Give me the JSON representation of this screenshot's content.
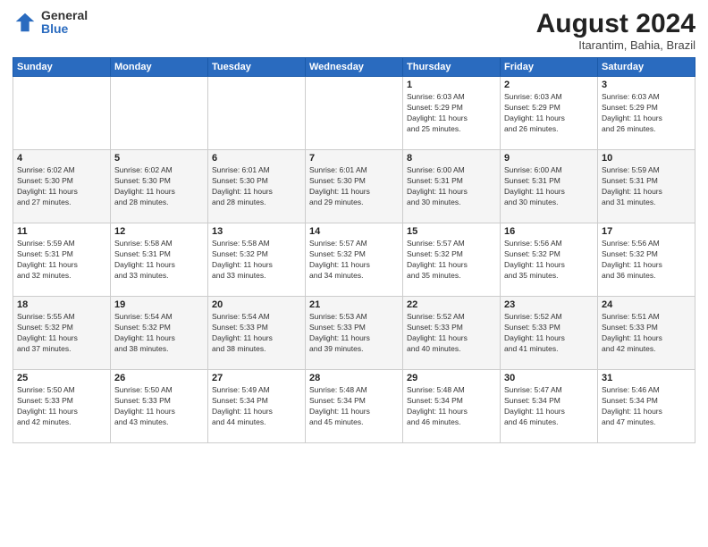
{
  "header": {
    "logo_general": "General",
    "logo_blue": "Blue",
    "month_year": "August 2024",
    "location": "Itarantim, Bahia, Brazil"
  },
  "weekdays": [
    "Sunday",
    "Monday",
    "Tuesday",
    "Wednesday",
    "Thursday",
    "Friday",
    "Saturday"
  ],
  "weeks": [
    [
      {
        "day": "",
        "info": ""
      },
      {
        "day": "",
        "info": ""
      },
      {
        "day": "",
        "info": ""
      },
      {
        "day": "",
        "info": ""
      },
      {
        "day": "1",
        "info": "Sunrise: 6:03 AM\nSunset: 5:29 PM\nDaylight: 11 hours\nand 25 minutes."
      },
      {
        "day": "2",
        "info": "Sunrise: 6:03 AM\nSunset: 5:29 PM\nDaylight: 11 hours\nand 26 minutes."
      },
      {
        "day": "3",
        "info": "Sunrise: 6:03 AM\nSunset: 5:29 PM\nDaylight: 11 hours\nand 26 minutes."
      }
    ],
    [
      {
        "day": "4",
        "info": "Sunrise: 6:02 AM\nSunset: 5:30 PM\nDaylight: 11 hours\nand 27 minutes."
      },
      {
        "day": "5",
        "info": "Sunrise: 6:02 AM\nSunset: 5:30 PM\nDaylight: 11 hours\nand 28 minutes."
      },
      {
        "day": "6",
        "info": "Sunrise: 6:01 AM\nSunset: 5:30 PM\nDaylight: 11 hours\nand 28 minutes."
      },
      {
        "day": "7",
        "info": "Sunrise: 6:01 AM\nSunset: 5:30 PM\nDaylight: 11 hours\nand 29 minutes."
      },
      {
        "day": "8",
        "info": "Sunrise: 6:00 AM\nSunset: 5:31 PM\nDaylight: 11 hours\nand 30 minutes."
      },
      {
        "day": "9",
        "info": "Sunrise: 6:00 AM\nSunset: 5:31 PM\nDaylight: 11 hours\nand 30 minutes."
      },
      {
        "day": "10",
        "info": "Sunrise: 5:59 AM\nSunset: 5:31 PM\nDaylight: 11 hours\nand 31 minutes."
      }
    ],
    [
      {
        "day": "11",
        "info": "Sunrise: 5:59 AM\nSunset: 5:31 PM\nDaylight: 11 hours\nand 32 minutes."
      },
      {
        "day": "12",
        "info": "Sunrise: 5:58 AM\nSunset: 5:31 PM\nDaylight: 11 hours\nand 33 minutes."
      },
      {
        "day": "13",
        "info": "Sunrise: 5:58 AM\nSunset: 5:32 PM\nDaylight: 11 hours\nand 33 minutes."
      },
      {
        "day": "14",
        "info": "Sunrise: 5:57 AM\nSunset: 5:32 PM\nDaylight: 11 hours\nand 34 minutes."
      },
      {
        "day": "15",
        "info": "Sunrise: 5:57 AM\nSunset: 5:32 PM\nDaylight: 11 hours\nand 35 minutes."
      },
      {
        "day": "16",
        "info": "Sunrise: 5:56 AM\nSunset: 5:32 PM\nDaylight: 11 hours\nand 35 minutes."
      },
      {
        "day": "17",
        "info": "Sunrise: 5:56 AM\nSunset: 5:32 PM\nDaylight: 11 hours\nand 36 minutes."
      }
    ],
    [
      {
        "day": "18",
        "info": "Sunrise: 5:55 AM\nSunset: 5:32 PM\nDaylight: 11 hours\nand 37 minutes."
      },
      {
        "day": "19",
        "info": "Sunrise: 5:54 AM\nSunset: 5:32 PM\nDaylight: 11 hours\nand 38 minutes."
      },
      {
        "day": "20",
        "info": "Sunrise: 5:54 AM\nSunset: 5:33 PM\nDaylight: 11 hours\nand 38 minutes."
      },
      {
        "day": "21",
        "info": "Sunrise: 5:53 AM\nSunset: 5:33 PM\nDaylight: 11 hours\nand 39 minutes."
      },
      {
        "day": "22",
        "info": "Sunrise: 5:52 AM\nSunset: 5:33 PM\nDaylight: 11 hours\nand 40 minutes."
      },
      {
        "day": "23",
        "info": "Sunrise: 5:52 AM\nSunset: 5:33 PM\nDaylight: 11 hours\nand 41 minutes."
      },
      {
        "day": "24",
        "info": "Sunrise: 5:51 AM\nSunset: 5:33 PM\nDaylight: 11 hours\nand 42 minutes."
      }
    ],
    [
      {
        "day": "25",
        "info": "Sunrise: 5:50 AM\nSunset: 5:33 PM\nDaylight: 11 hours\nand 42 minutes."
      },
      {
        "day": "26",
        "info": "Sunrise: 5:50 AM\nSunset: 5:33 PM\nDaylight: 11 hours\nand 43 minutes."
      },
      {
        "day": "27",
        "info": "Sunrise: 5:49 AM\nSunset: 5:34 PM\nDaylight: 11 hours\nand 44 minutes."
      },
      {
        "day": "28",
        "info": "Sunrise: 5:48 AM\nSunset: 5:34 PM\nDaylight: 11 hours\nand 45 minutes."
      },
      {
        "day": "29",
        "info": "Sunrise: 5:48 AM\nSunset: 5:34 PM\nDaylight: 11 hours\nand 46 minutes."
      },
      {
        "day": "30",
        "info": "Sunrise: 5:47 AM\nSunset: 5:34 PM\nDaylight: 11 hours\nand 46 minutes."
      },
      {
        "day": "31",
        "info": "Sunrise: 5:46 AM\nSunset: 5:34 PM\nDaylight: 11 hours\nand 47 minutes."
      }
    ]
  ]
}
